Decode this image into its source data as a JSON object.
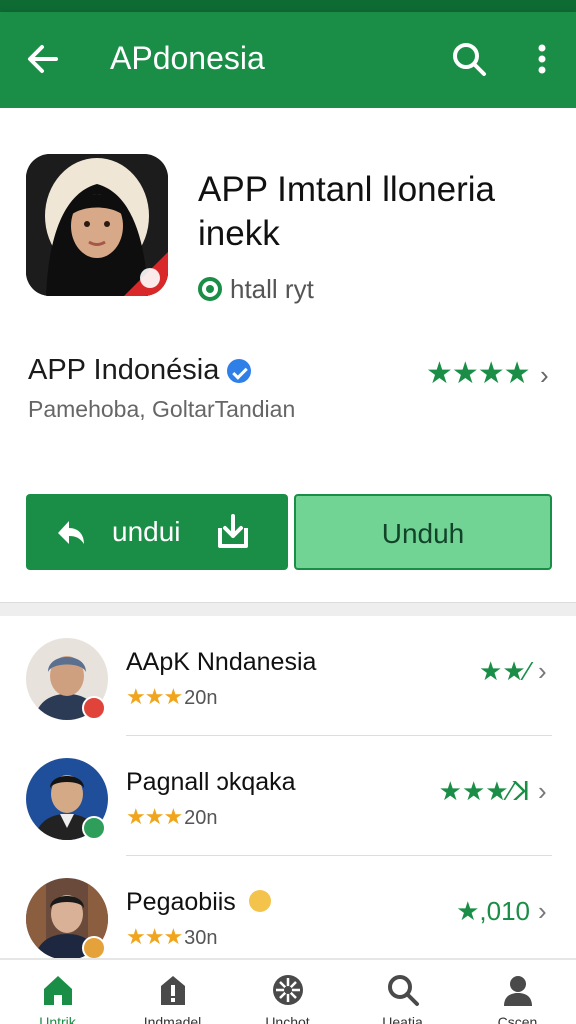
{
  "appbar": {
    "title": "APdonesia",
    "back_icon": "arrow-left-icon",
    "search_icon": "search-icon",
    "more_icon": "more-vert-icon",
    "color": "#1a8e46"
  },
  "app": {
    "title_line1": "APP Imtanl lloneria",
    "title_line2": "inekk",
    "install_status": "htall ryt",
    "developer": "APP Indonésia",
    "developer_sub": "Pamehoba, GoltarTandian",
    "rating_stars": "★★★★",
    "buttons": {
      "primary_label": "undui",
      "secondary_label": "Unduh"
    }
  },
  "list": [
    {
      "name": "AApK Nndanesia",
      "stars": "★★★",
      "count": "20n",
      "rating": "★★⁄"
    },
    {
      "name": "Pagnall ɔkqaka",
      "stars": "★★★",
      "count": "20n",
      "rating": "★★★⁄ꓘ"
    },
    {
      "name": "Pegaobiis",
      "stars": "★★★",
      "count": "30n",
      "rating": "★,010"
    }
  ],
  "bottom_nav": [
    {
      "label": "Untrik",
      "icon": "home-icon",
      "active": true
    },
    {
      "label": "Indmadel",
      "icon": "alert-icon",
      "active": false
    },
    {
      "label": "Unchot",
      "icon": "apps-icon",
      "active": false
    },
    {
      "label": "Ueatia",
      "icon": "search-icon",
      "active": false
    },
    {
      "label": "Cscen",
      "icon": "profile-icon",
      "active": false
    }
  ],
  "colors": {
    "primary": "#1a8e46",
    "primary_light": "#72d494",
    "star_gold": "#f0a51c"
  }
}
